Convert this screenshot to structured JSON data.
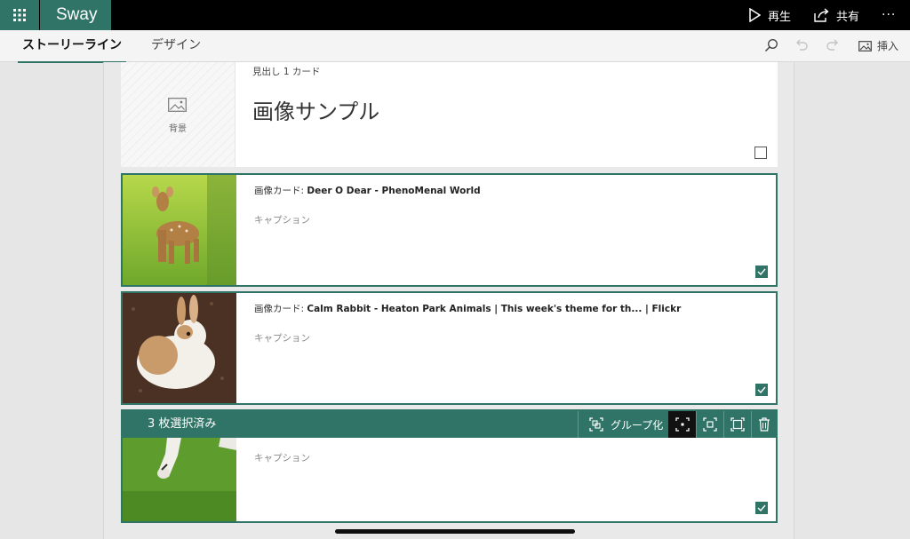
{
  "app": {
    "name": "Sway"
  },
  "topbar": {
    "play_label": "再生",
    "share_label": "共有",
    "more_label": "···"
  },
  "tabs": [
    {
      "label": "ストーリーライン",
      "active": true
    },
    {
      "label": "デザイン",
      "active": false
    }
  ],
  "toolbar": {
    "insert_label": "挿入"
  },
  "heading_card": {
    "type_label": "見出し 1 カード",
    "title": "画像サンプル",
    "background_label": "背景",
    "checked": false
  },
  "image_cards": [
    {
      "prefix": "画像カード: ",
      "title": "Deer O Dear - PhenoMenal World",
      "caption_placeholder": "キャプション",
      "checked": true
    },
    {
      "prefix": "画像カード: ",
      "title": "Calm Rabbit - Heaton Park Animals | This week's theme for th... | Flickr",
      "caption_placeholder": "キャプション",
      "checked": true
    }
  ],
  "selection_card": {
    "count_label": "3 枚選択済み",
    "group_label": "グループ化",
    "caption_placeholder": "キャプション",
    "checked": true
  },
  "colors": {
    "accent": "#2f7466",
    "topbar": "#000000",
    "canvas": "#e9e9e9"
  }
}
